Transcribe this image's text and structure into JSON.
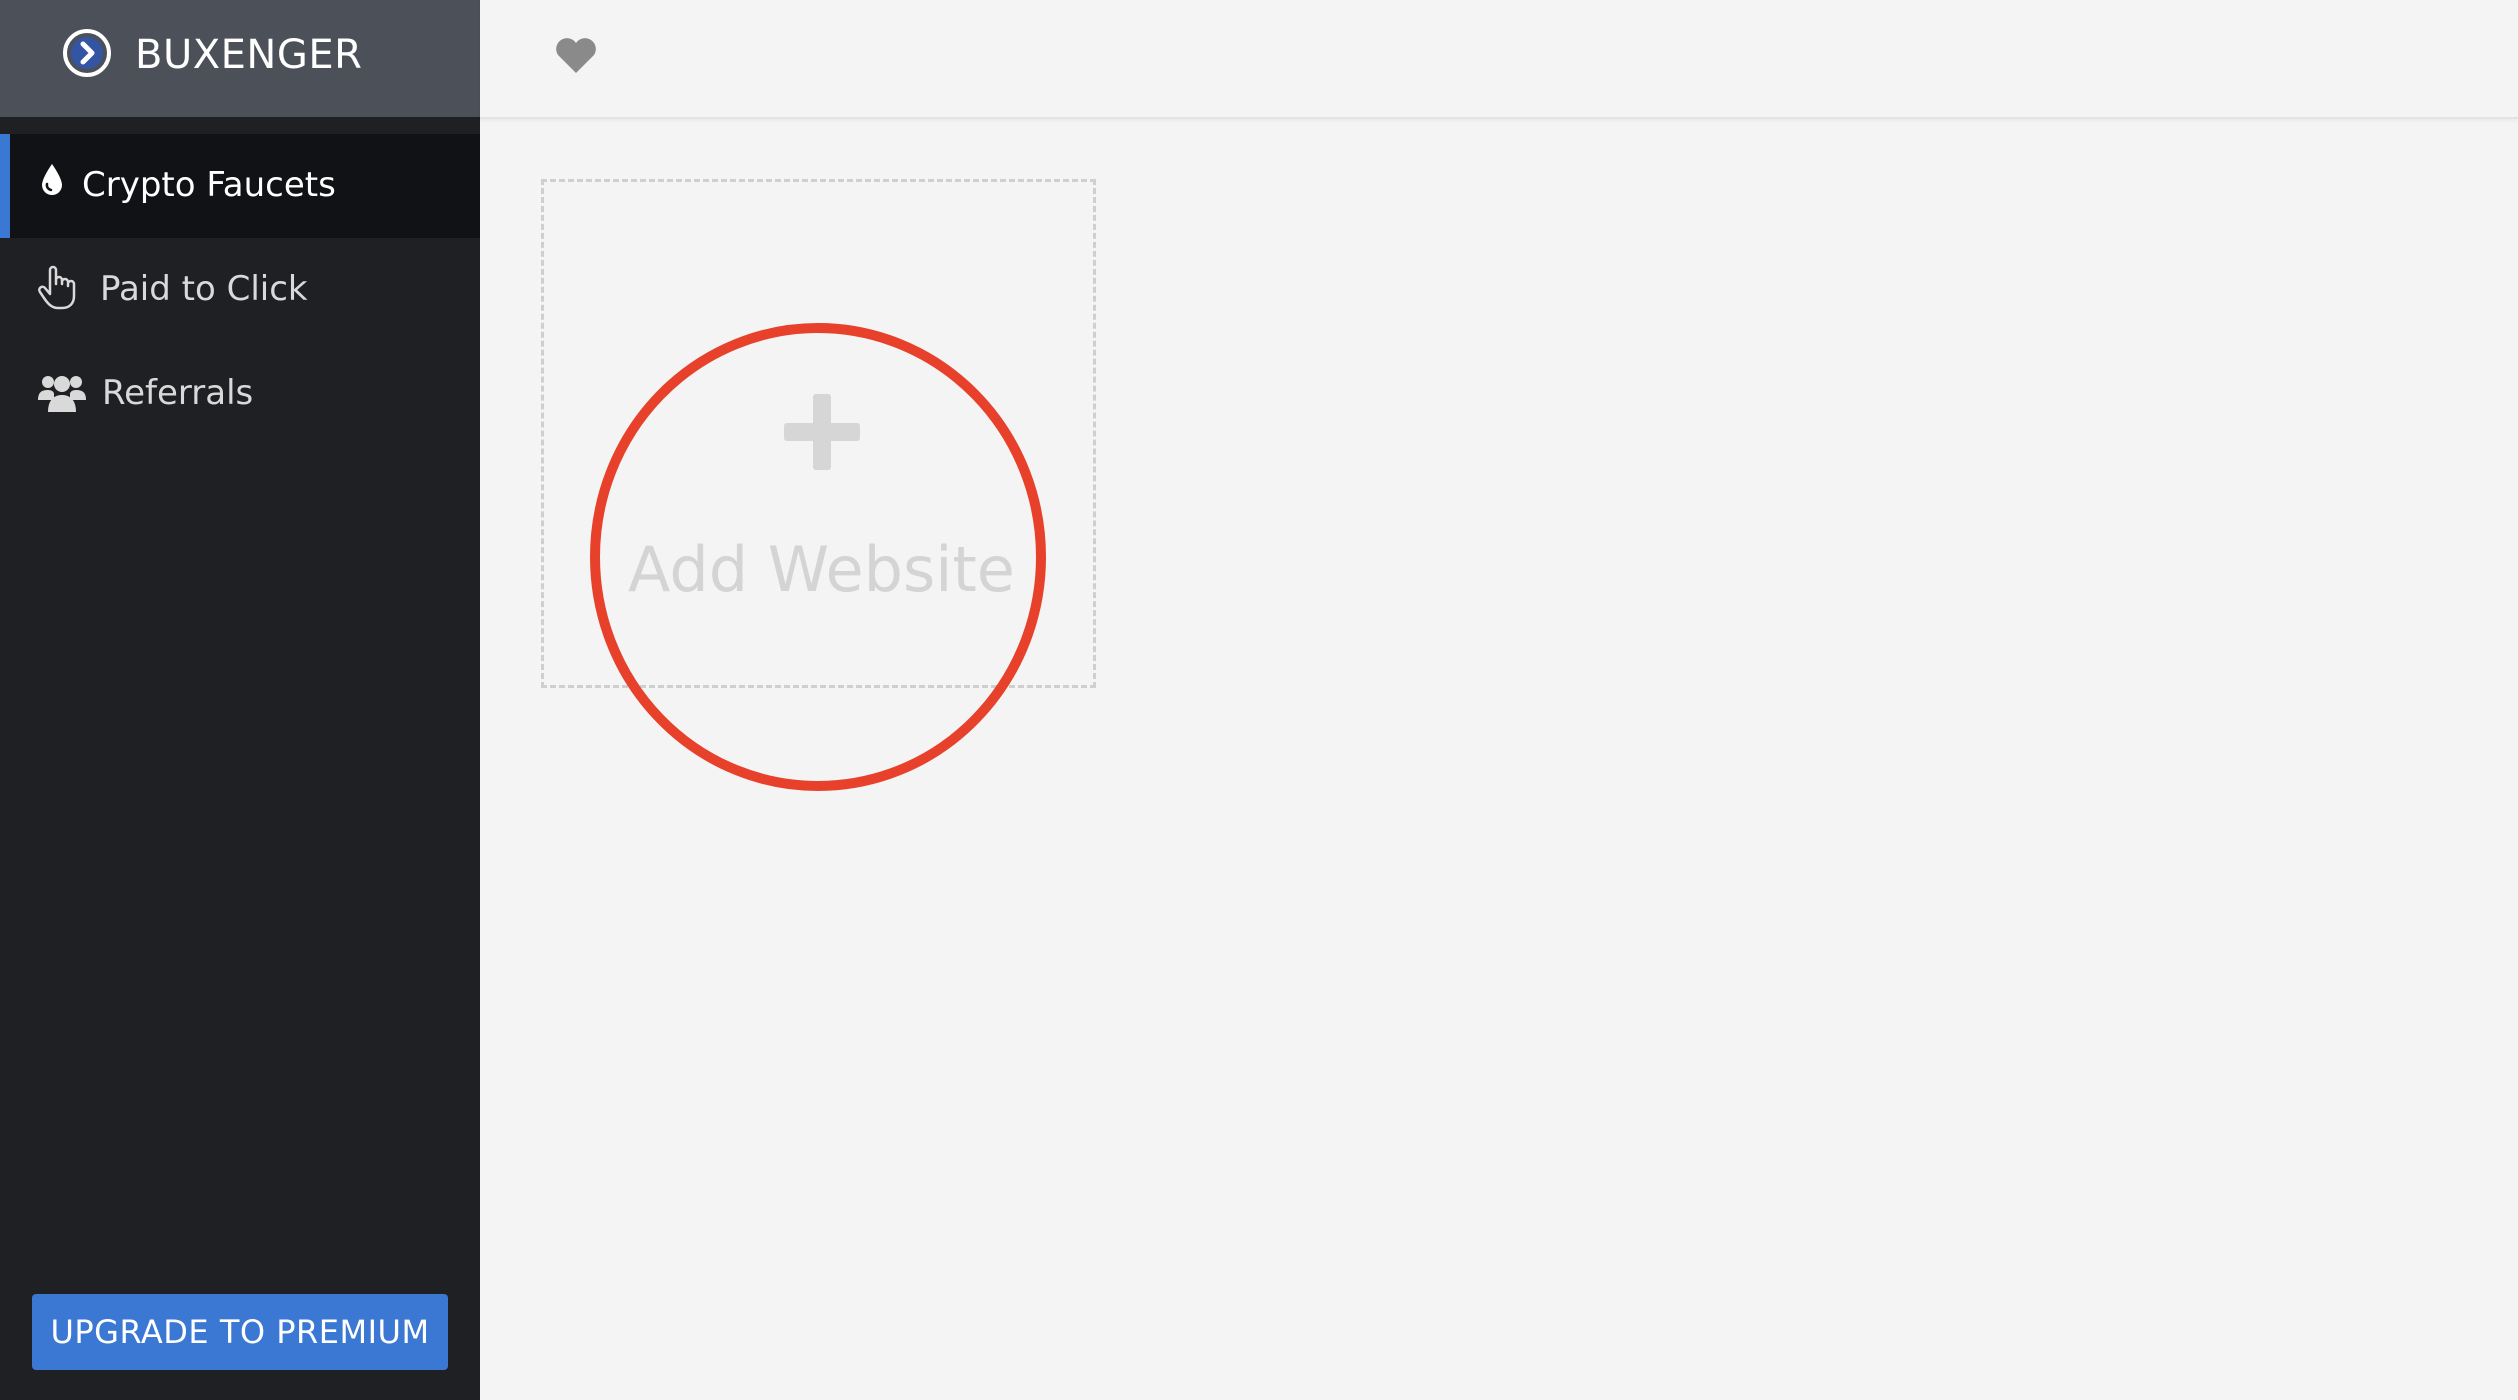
{
  "brand": {
    "name": "BUXENGER",
    "icon": "chevron-right-circle-icon"
  },
  "sidebar": {
    "items": [
      {
        "label": "Crypto Faucets",
        "icon": "droplet-icon",
        "active": true
      },
      {
        "label": "Paid to Click",
        "icon": "pointer-hand-icon",
        "active": false
      },
      {
        "label": "Referrals",
        "icon": "users-group-icon",
        "active": false
      }
    ],
    "premium_button": "UPGRADE TO PREMIUM"
  },
  "topbar": {
    "icon": "heart-icon"
  },
  "main": {
    "add_card": {
      "label": "Add Website",
      "icon": "plus-icon"
    }
  },
  "colors": {
    "sidebar_bg": "#1f2024",
    "brand_bg": "#4b5059",
    "accent": "#3a78d4",
    "highlight": "#e8412b",
    "content_bg": "#f4f4f4"
  }
}
